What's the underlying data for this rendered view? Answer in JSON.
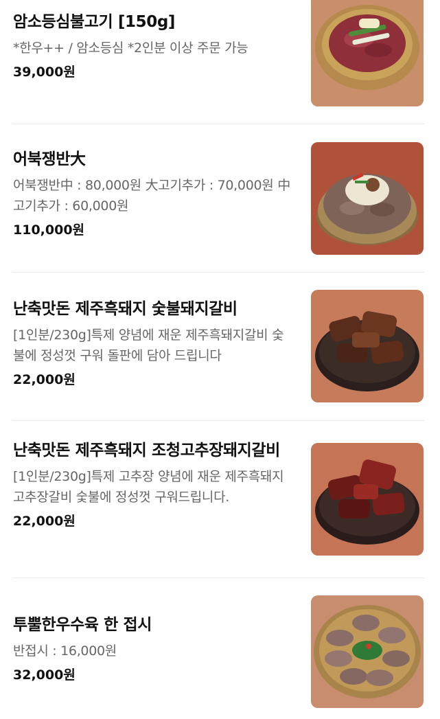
{
  "menu": {
    "items": [
      {
        "name": "암소등심불고기 [150g]",
        "description": "*한우++ / 암소등심 *2인분 이상 주문 가능",
        "price": "39,000원",
        "image": "beef-bulgogi-photo",
        "colors": {
          "bg": "#c98e6a",
          "plate": "#c9a35a",
          "meat": "#8e2f3a"
        }
      },
      {
        "name": "어북쟁반大",
        "description": "어북쟁반中 : 80,000원 大고기추가 : 70,000원 中고기추가 : 60,000원",
        "price": "110,000원",
        "image": "eobuk-jaengban-photo",
        "colors": {
          "bg": "#b0523a",
          "plate": "#a78a58",
          "meat": "#7d6358"
        }
      },
      {
        "name": "난축맛돈 제주흑돼지 숯불돼지갈비",
        "description": "[1인분/230g]특제 양념에 재운 제주흑돼지갈비 숯불에 정성껏 구워 돌판에 담아 드립니다",
        "price": "22,000원",
        "image": "grilled-pork-ribs-photo",
        "colors": {
          "bg": "#c67c5b",
          "plate": "#3c2c26",
          "meat": "#5a2c1c"
        }
      },
      {
        "name": "난축맛돈 제주흑돼지 조청고추장돼지갈비",
        "description": "[1인분/230g]특제 고추장 양념에 재운 제주흑돼지고추장갈비 숯불에 정성껏 구워드립니다.",
        "price": "22,000원",
        "image": "gochujang-pork-ribs-photo",
        "colors": {
          "bg": "#c57556",
          "plate": "#3c2a26",
          "meat": "#6a1a17"
        }
      },
      {
        "name": "투뿔한우수육 한 접시",
        "description": "반접시 : 16,000원",
        "price": "32,000원",
        "image": "boiled-beef-suyuk-photo",
        "colors": {
          "bg": "#c88d6e",
          "plate": "#c19a5a",
          "meat": "#8a6d66"
        }
      }
    ]
  }
}
